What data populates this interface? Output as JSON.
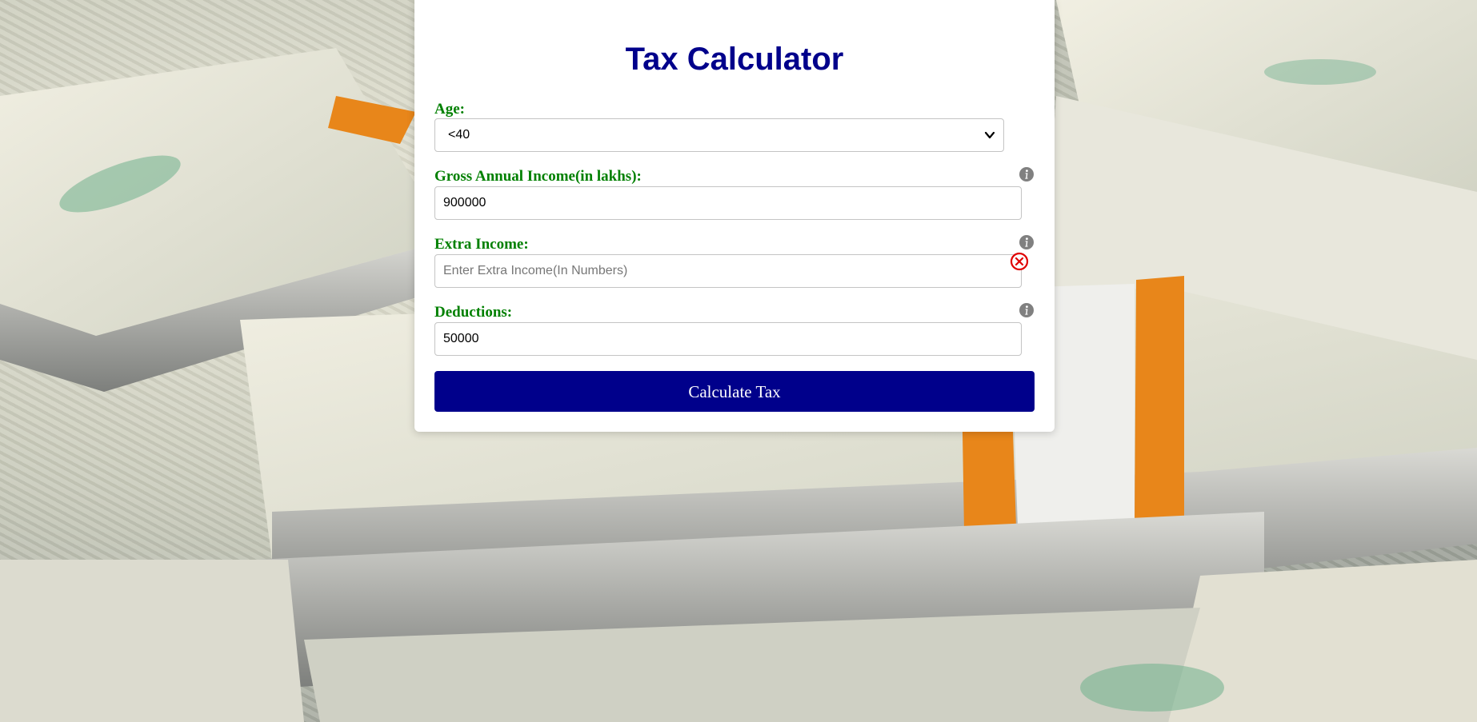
{
  "app": {
    "title": "Tax Calculator"
  },
  "form": {
    "age": {
      "label": "Age:",
      "selected": "<40"
    },
    "gross_income": {
      "label": "Gross Annual Income(in lakhs):",
      "value": "900000",
      "icon": "info-icon"
    },
    "extra_income": {
      "label": "Extra Income:",
      "value": "",
      "placeholder": "Enter Extra Income(In Numbers)",
      "icon": "info-icon",
      "error_icon": "error-circle-icon"
    },
    "deductions": {
      "label": "Deductions:",
      "value": "50000",
      "icon": "info-icon"
    },
    "submit_label": "Calculate Tax"
  },
  "colors": {
    "title": "#00008b",
    "label": "#008000",
    "button_bg": "#00008b",
    "error": "#e00000",
    "info": "#808080"
  }
}
